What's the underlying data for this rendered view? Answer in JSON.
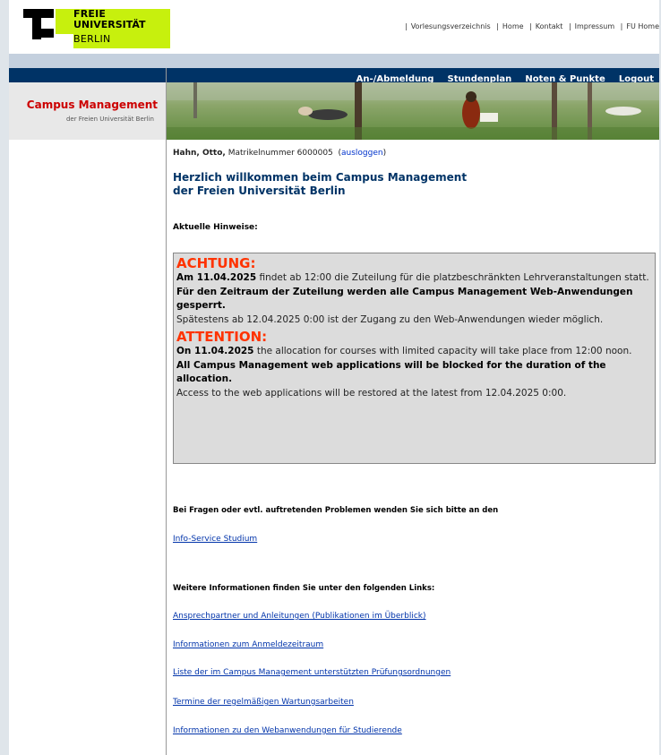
{
  "logo": {
    "line1": "FREIE",
    "line2": "UNIVERSITÄT",
    "line3": "BERLIN"
  },
  "topnav": [
    "Vorlesungsverzeichnis",
    "Home",
    "Kontakt",
    "Impressum",
    "FU Home"
  ],
  "navbar": [
    "An-/Abmeldung",
    "Stundenplan",
    "Noten & Punkte",
    "Logout"
  ],
  "sidebar": {
    "title": "Campus Management",
    "subtitle": "der Freien Universität Berlin"
  },
  "user": {
    "name": "Hahn, Otto,",
    "matrikel": " Matrikelnummer 6000005",
    "logout": "ausloggen"
  },
  "welcome": {
    "line1": "Herzlich willkommen beim Campus Management",
    "line2": "der Freien Universität Berlin"
  },
  "hint_title": "Aktuelle Hinweise:",
  "notice": {
    "de_heading": "ACHTUNG:",
    "de_date": "Am 11.04.2025",
    "de_text1": " findet ab 12:00 die Zuteilung für die platzbeschränkten Lehrveranstaltungen statt.",
    "de_bold": "Für den Zeitraum der Zuteilung werden alle Campus Management Web-Anwendungen gesperrt.",
    "de_text2": "Spätestens ab 12.04.2025 0:00 ist der Zugang zu den Web-Anwendungen wieder möglich.",
    "en_heading": "ATTENTION:",
    "en_date": "On 11.04.2025",
    "en_text1": " the allocation for courses with limited capacity will take place from 12:00 noon.",
    "en_bold": "All Campus Management web applications will be blocked for the duration of the allocation.",
    "en_text2": "Access to the web applications will be restored at the latest from 12.04.2025 0:00."
  },
  "question": "Bei Fragen oder evtl. auftretenden Problemen wenden Sie sich bitte an den",
  "info_link": "Info-Service Studium",
  "further": "Weitere Informationen finden Sie unter den folgenden Links:",
  "links": [
    "Ansprechpartner und Anleitungen (Publikationen im Überblick)",
    "Informationen zum Anmeldezeitraum",
    "Liste der im Campus Management unterstützten Prüfungsordnungen",
    "Termine der regelmäßigen Wartungsarbeiten",
    "Informationen zu den Webanwendungen für Studierende"
  ]
}
